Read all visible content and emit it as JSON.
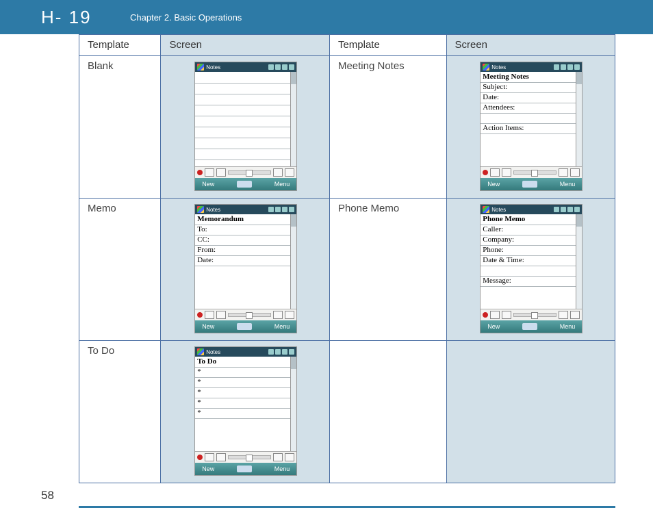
{
  "header": {
    "logo": "H- 19",
    "chapter": "Chapter 2. Basic Operations"
  },
  "pagenum": "58",
  "topbar": {
    "app": "Notes"
  },
  "bottombar": {
    "left": "New",
    "right": "Menu"
  },
  "table": {
    "head": [
      "Template",
      "Screen",
      "Template",
      "Screen"
    ],
    "rows": [
      {
        "left_name": "Blank",
        "right_name": "Meeting Notes"
      },
      {
        "left_name": "Memo",
        "right_name": "Phone Memo"
      },
      {
        "left_name": "To Do",
        "right_name": ""
      }
    ]
  },
  "notes": {
    "blank": {
      "title": "",
      "lines": []
    },
    "meeting": {
      "title": "Meeting Notes",
      "lines": [
        "Subject:",
        "Date:",
        "Attendees:",
        "",
        "Action Items:"
      ]
    },
    "memo": {
      "title": "Memorandum",
      "lines": [
        "To:",
        "CC:",
        "From:",
        "Date:"
      ]
    },
    "phonememo": {
      "title": "Phone Memo",
      "lines": [
        "Caller:",
        "Company:",
        "Phone:",
        "Date & Time:",
        "",
        "Message:"
      ]
    },
    "todo": {
      "title": "To Do",
      "lines": [
        "*",
        "*",
        "*",
        "*",
        "*"
      ]
    }
  }
}
